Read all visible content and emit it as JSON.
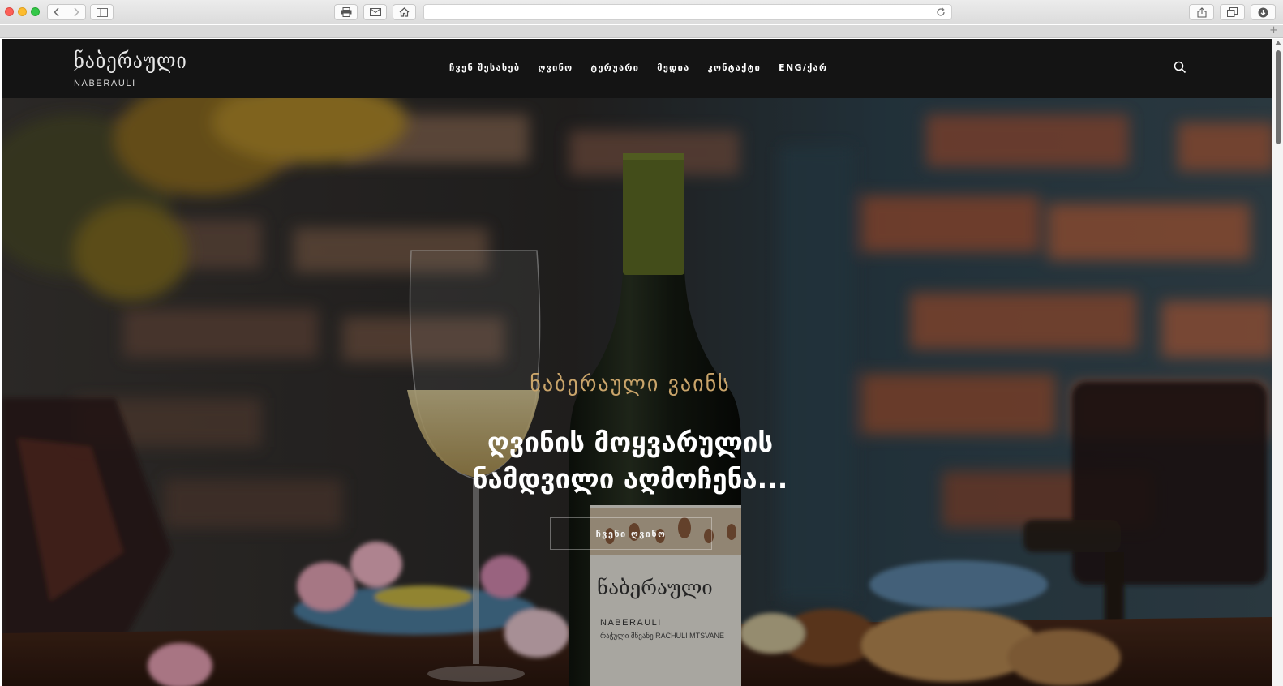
{
  "browser": {
    "address_value": ""
  },
  "header": {
    "logo_georgian": "ნაბერაული",
    "logo_latin": "NABERAULI",
    "nav": [
      {
        "label": "ჩვენ შესახებ"
      },
      {
        "label": "ღვინო"
      },
      {
        "label": "ტერუარი"
      },
      {
        "label": "მედია"
      },
      {
        "label": "კონტაქტი"
      },
      {
        "label": "ENG/ქარ"
      }
    ]
  },
  "hero": {
    "kicker": "ნაბერაული ვაინს",
    "title_line1": "ღვინის მოყვარულის",
    "title_line2": "ნამდვილი აღმოჩენა...",
    "cta_label": "ჩვენი ღვინო",
    "bottle_label": {
      "brand_georgian": "ნაბერაული",
      "brand_latin": "NABERAULI",
      "variety": "რაჭული მწვანე RACHULI MTSVANE"
    }
  },
  "colors": {
    "header_bg": "#141414",
    "kicker_gold": "#c9a46a",
    "text_white": "#ffffff"
  },
  "icons": [
    "print-icon",
    "mail-icon",
    "home-icon",
    "reload-icon",
    "share-icon",
    "tabs-icon",
    "download-icon",
    "search-icon"
  ]
}
